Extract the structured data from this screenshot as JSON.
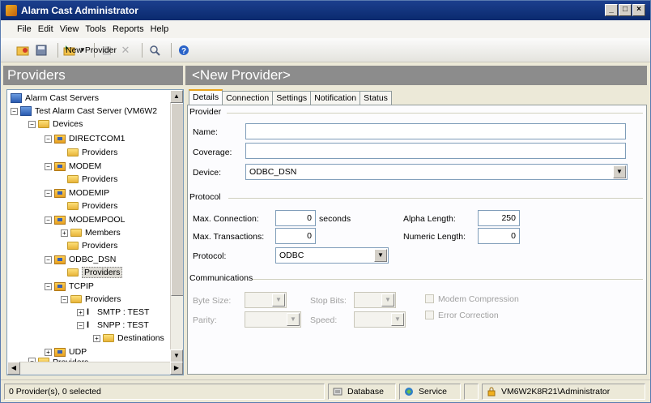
{
  "window": {
    "title": "Alarm Cast Administrator",
    "controls": [
      "_",
      "□",
      "×"
    ]
  },
  "menu": [
    "File",
    "Edit",
    "View",
    "Tools",
    "Reports",
    "Help"
  ],
  "toolbar": {
    "new_provider_label": "New Provider"
  },
  "left_header": "Providers",
  "right_header": "<New Provider>",
  "tree": {
    "root": "Alarm Cast Servers",
    "server": "Test Alarm Cast Server (VM6W2",
    "devices": "Devices",
    "directcom": "DIRECTCOM1",
    "providers": "Providers",
    "modem": "MODEM",
    "modemip": "MODEMIP",
    "modempool": "MODEMPOOL",
    "members": "Members",
    "odbc": "ODBC_DSN",
    "tcpip": "TCPIP",
    "smtp": "SMTP : TEST",
    "snpp": "SNPP : TEST",
    "destinations": "Destinations",
    "udp": "UDP",
    "providers_root": "Providers"
  },
  "tabs": [
    "Details",
    "Connection",
    "Settings",
    "Notification",
    "Status"
  ],
  "provider_group": {
    "title": "Provider",
    "name_label": "Name:",
    "name_value": "",
    "coverage_label": "Coverage:",
    "coverage_value": "",
    "device_label": "Device:",
    "device_value": "ODBC_DSN"
  },
  "protocol_group": {
    "title": "Protocol",
    "max_connection_label": "Max. Connection:",
    "max_connection_value": "0",
    "seconds_label": "seconds",
    "max_transactions_label": "Max. Transactions:",
    "max_transactions_value": "0",
    "protocol_label": "Protocol:",
    "protocol_value": "ODBC",
    "alpha_length_label": "Alpha Length:",
    "alpha_length_value": "250",
    "numeric_length_label": "Numeric Length:",
    "numeric_length_value": "0"
  },
  "communications_group": {
    "title": "Communications",
    "byte_size_label": "Byte Size:",
    "stop_bits_label": "Stop Bits:",
    "parity_label": "Parity:",
    "speed_label": "Speed:",
    "modem_compression_label": "Modem Compression",
    "error_correction_label": "Error Correction"
  },
  "status": {
    "selection": "0 Provider(s), 0 selected",
    "database": "Database",
    "service": "Service",
    "user": "VM6W2K8R21\\Administrator"
  },
  "colors": {
    "title_bar": "#0a2a6e",
    "panel_header": "#8c8c8c",
    "active_tab_accent": "#e8a21c"
  }
}
